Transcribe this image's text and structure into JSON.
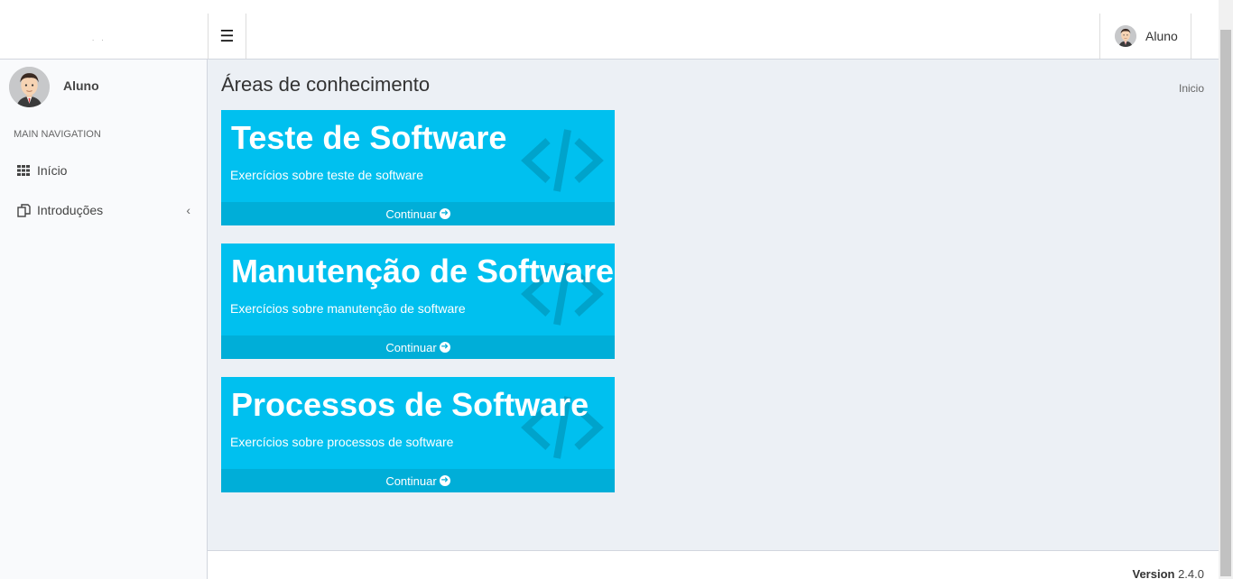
{
  "header": {
    "brand_text": ". .",
    "toggle_icon": "hamburger-icon",
    "user_name": "Aluno"
  },
  "sidebar": {
    "user_name": "Aluno",
    "nav_header": "MAIN NAVIGATION",
    "items": [
      {
        "label": "Início",
        "icon": "grid-icon"
      },
      {
        "label": "Introduções",
        "icon": "copy-icon",
        "chevron": "‹"
      }
    ]
  },
  "content": {
    "title": "Áreas de conhecimento",
    "breadcrumb": "Inicio",
    "cards": [
      {
        "title": "Teste de Software",
        "subtitle": "Exercícios sobre teste de software",
        "footer": "Continuar"
      },
      {
        "title": "Manutenção de Software",
        "subtitle": "Exercícios sobre manutenção de software",
        "footer": "Continuar"
      },
      {
        "title": "Processos de Software",
        "subtitle": "Exercícios sobre processos de software",
        "footer": "Continuar"
      }
    ]
  },
  "footer": {
    "version_label": "Version",
    "version_number": "2.4.0"
  },
  "colors": {
    "card": "#00c0ef",
    "card_footer": "#00aed8",
    "background": "#ecf0f5"
  }
}
